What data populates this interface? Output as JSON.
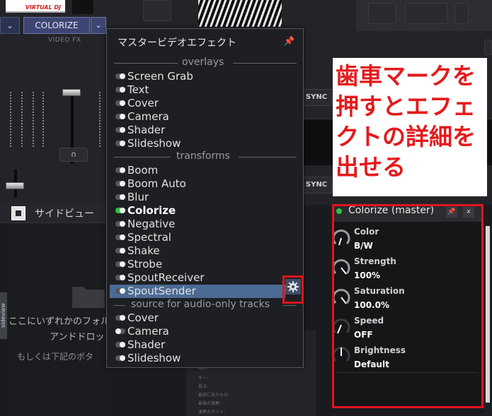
{
  "background": {
    "logo_text": "VIRTUAL DJ",
    "video_fx": {
      "selected_effect": "COLORIZE",
      "label": "VIDEO FX"
    },
    "sync_label": "SYNC",
    "side_view": {
      "title": "サイドビュー",
      "tab_label": "sideview",
      "hint_line1": "ここにいずれかのフォル",
      "hint_line2": "アンドドロッ",
      "hint_line3": "もしくは下記のボタ"
    },
    "info_lines": [
      "Bpm:",
      "キー:",
      "長さ:",
      "最初に見たもの:",
      "最後の演奏:",
      "演奏カウント:"
    ]
  },
  "menu": {
    "title": "マスタービデオエフェクト",
    "sections": [
      {
        "label": "overlays",
        "items": [
          {
            "label": "Screen Grab",
            "state": "off"
          },
          {
            "label": "Text",
            "state": "off"
          },
          {
            "label": "Cover",
            "state": "off"
          },
          {
            "label": "Camera",
            "state": "off"
          },
          {
            "label": "Shader",
            "state": "off"
          },
          {
            "label": "Slideshow",
            "state": "off"
          }
        ]
      },
      {
        "label": "transforms",
        "items": [
          {
            "label": "Boom",
            "state": "off"
          },
          {
            "label": "Boom Auto",
            "state": "off"
          },
          {
            "label": "Blur",
            "state": "off"
          },
          {
            "label": "Colorize",
            "state": "on"
          },
          {
            "label": "Negative",
            "state": "off"
          },
          {
            "label": "Spectral",
            "state": "off"
          },
          {
            "label": "Shake",
            "state": "off"
          },
          {
            "label": "Strobe",
            "state": "off"
          },
          {
            "label": "SpoutReceiver",
            "state": "off"
          },
          {
            "label": "SpoutSender",
            "state": "off"
          }
        ]
      },
      {
        "label": "source for audio-only tracks",
        "items": [
          {
            "label": "Cover",
            "state": "off"
          },
          {
            "label": "Camera",
            "state": "half"
          },
          {
            "label": "Shader",
            "state": "off"
          },
          {
            "label": "Slideshow",
            "state": "off"
          }
        ]
      }
    ]
  },
  "annotation": {
    "text": "歯車マークを押すとエフェクトの詳細を出せる",
    "color": "#e41a1c"
  },
  "colorize_panel": {
    "title": "Colorize (master)",
    "pin_label": "✎",
    "close_label": "x",
    "params": [
      {
        "name": "Color",
        "value": "B/W"
      },
      {
        "name": "Strength",
        "value": "100%"
      },
      {
        "name": "Saturation",
        "value": "100.0%"
      },
      {
        "name": "Speed",
        "value": "OFF"
      },
      {
        "name": "Brightness",
        "value": "Default"
      }
    ]
  },
  "colors": {
    "accent_on": "#27c43a",
    "selected_row": "#4c6b94",
    "highlight_red": "#e3141b"
  }
}
